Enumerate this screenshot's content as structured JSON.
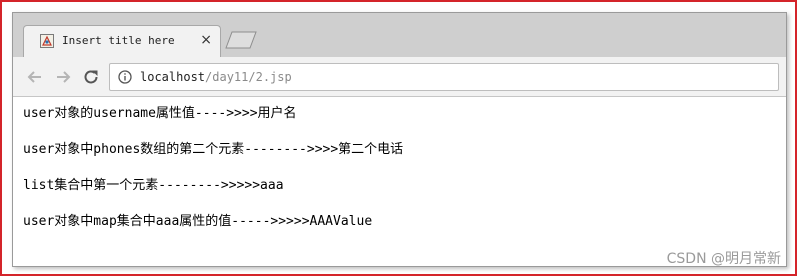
{
  "browser": {
    "tab_title": "Insert title here",
    "tab_close": "×",
    "url_host": "localhost",
    "url_path": "/day11/2.jsp"
  },
  "page": {
    "lines": [
      "user对象的username属性值---->>>>用户名",
      "user对象中phones数组的第二个元素-------->>>>第二个电话",
      "list集合中第一个元素-------->>>>>aaa",
      "user对象中map集合中aaa属性的值----->>>>>AAAValue"
    ]
  },
  "watermark": "CSDN @明月常新",
  "colors": {
    "frame_border": "#d4242a",
    "tabstrip": "#cfcfcf",
    "toolbar": "#f2f2f2"
  }
}
